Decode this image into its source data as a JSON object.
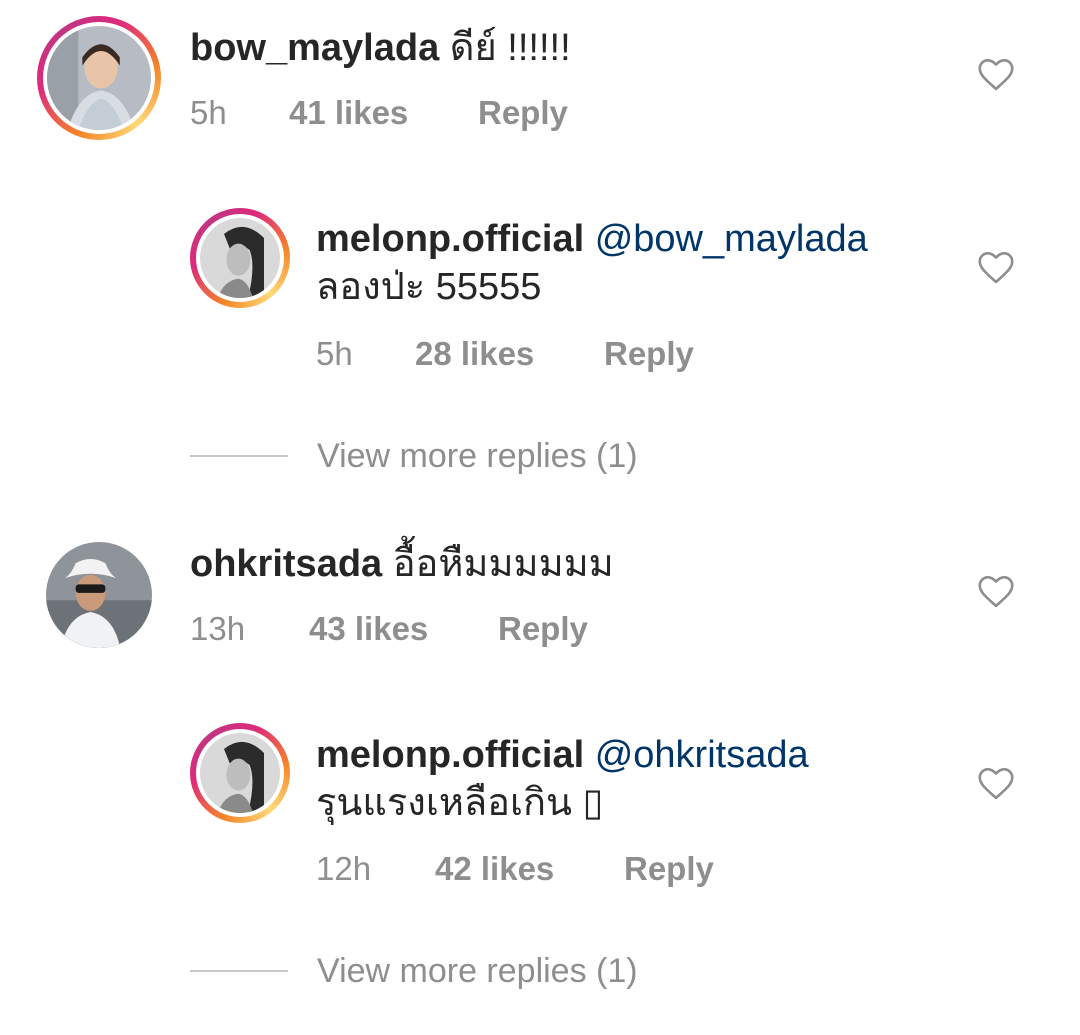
{
  "comments": [
    {
      "username": "bow_maylada",
      "text": "ดีย์ !!!!!!",
      "time": "5h",
      "likes": "41 likes",
      "reply": "Reply",
      "avatar_icon": "avatar-photo-woman",
      "story_ring": true,
      "replies": [
        {
          "username": "melonp.official",
          "mention": "@bow_maylada",
          "text": "ลองป่ะ 55555",
          "time": "5h",
          "likes": "28 likes",
          "reply": "Reply",
          "avatar_icon": "avatar-photo-woman-bw",
          "story_ring": true
        }
      ],
      "view_more": "View more replies (1)"
    },
    {
      "username": "ohkritsada",
      "text": "อื้อหืมมมมมม",
      "time": "13h",
      "likes": "43 likes",
      "reply": "Reply",
      "avatar_icon": "avatar-photo-man-hat",
      "story_ring": false,
      "replies": [
        {
          "username": "melonp.official",
          "mention": "@ohkritsada",
          "text": "รุนแรงเหลือเกิน",
          "emoji": "▯",
          "time": "12h",
          "likes": "42 likes",
          "reply": "Reply",
          "avatar_icon": "avatar-photo-woman-bw",
          "story_ring": true
        }
      ],
      "view_more": "View more replies (1)"
    }
  ],
  "icons": {
    "like": "heart-outline-icon"
  },
  "colors": {
    "text": "#262626",
    "muted": "#8e8e8e",
    "mention": "#003569",
    "ring_start": "#f58529",
    "ring_end": "#dd2a7b"
  }
}
